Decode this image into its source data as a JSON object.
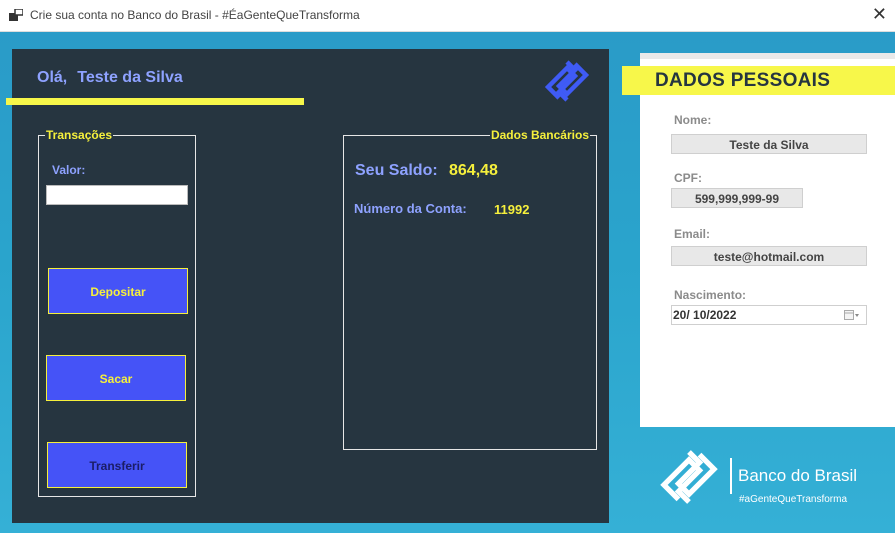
{
  "window": {
    "title": "Crie sua conta no Banco do Brasil - #ÉaGenteQueTransforma",
    "close_glyph": "✕"
  },
  "header": {
    "greeting": "Olá,",
    "user_name": "Teste da Silva",
    "logo": "banco-do-brasil-logo"
  },
  "transacoes": {
    "legend": "Transações",
    "valor_label": "Valor:",
    "valor_value": "",
    "buttons": {
      "depositar": "Depositar",
      "sacar": "Sacar",
      "transferir": "Transferir"
    }
  },
  "dados_bancarios": {
    "legend": "Dados Bancários",
    "saldo_label": "Seu Saldo:",
    "saldo_value": "864,48",
    "conta_label": "Número da Conta:",
    "conta_value": "11992"
  },
  "dados_pessoais": {
    "title": "DADOS PESSOAIS",
    "nome_label": "Nome:",
    "nome_value": "Teste da Silva",
    "cpf_label": "CPF:",
    "cpf_value": "599,999,999-99",
    "email_label": "Email:",
    "email_value": "teste@hotmail.com",
    "nascimento_label": "Nascimento:",
    "nascimento_value": "20/ 10/2022"
  },
  "branding": {
    "name": "Banco do Brasil",
    "tagline": "#aGenteQueTransforma"
  },
  "colors": {
    "panel": "#263540",
    "accent_yellow": "#f6f03c",
    "label_blue": "#8ea2ff",
    "button_blue": "#4553f7",
    "logo_blue": "#3f5bf5"
  }
}
